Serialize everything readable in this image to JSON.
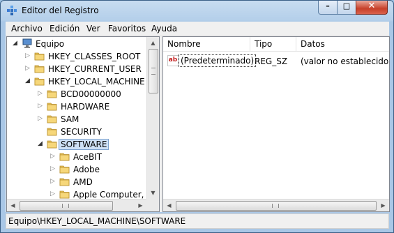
{
  "window": {
    "title": "Editor del Registro"
  },
  "menu": [
    "Archivo",
    "Edición",
    "Ver",
    "Favoritos",
    "Ayuda"
  ],
  "tree": {
    "items": [
      {
        "label": "Equipo",
        "level": 0,
        "arrow": "expanded",
        "icon": "computer-icon",
        "selected": false
      },
      {
        "label": "HKEY_CLASSES_ROOT",
        "level": 1,
        "arrow": "collapsed",
        "icon": "folder-icon",
        "selected": false
      },
      {
        "label": "HKEY_CURRENT_USER",
        "level": 1,
        "arrow": "collapsed",
        "icon": "folder-icon",
        "selected": false
      },
      {
        "label": "HKEY_LOCAL_MACHINE",
        "level": 1,
        "arrow": "expanded",
        "icon": "folder-open-icon",
        "selected": false
      },
      {
        "label": "BCD00000000",
        "level": 2,
        "arrow": "collapsed",
        "icon": "folder-icon",
        "selected": false
      },
      {
        "label": "HARDWARE",
        "level": 2,
        "arrow": "collapsed",
        "icon": "folder-icon",
        "selected": false
      },
      {
        "label": "SAM",
        "level": 2,
        "arrow": "collapsed",
        "icon": "folder-icon",
        "selected": false
      },
      {
        "label": "SECURITY",
        "level": 2,
        "arrow": "none",
        "icon": "folder-icon",
        "selected": false
      },
      {
        "label": "SOFTWARE",
        "level": 2,
        "arrow": "expanded",
        "icon": "folder-open-icon",
        "selected": true
      },
      {
        "label": "AceBIT",
        "level": 3,
        "arrow": "collapsed",
        "icon": "folder-icon",
        "selected": false
      },
      {
        "label": "Adobe",
        "level": 3,
        "arrow": "collapsed",
        "icon": "folder-icon",
        "selected": false
      },
      {
        "label": "AMD",
        "level": 3,
        "arrow": "collapsed",
        "icon": "folder-icon",
        "selected": false
      },
      {
        "label": "Apple Computer, I",
        "level": 3,
        "arrow": "collapsed",
        "icon": "folder-icon",
        "selected": false
      }
    ]
  },
  "list": {
    "columns": [
      "Nombre",
      "Tipo",
      "Datos"
    ],
    "rows": [
      {
        "icon": "string-value-icon",
        "icon_text": "ab",
        "name": "(Predeterminado)",
        "type": "REG_SZ",
        "data": "(valor no establecido)"
      }
    ]
  },
  "status": {
    "path": "Equipo\\HKEY_LOCAL_MACHINE\\SOFTWARE"
  },
  "colors": {
    "selection": "#cfe1f6",
    "folder": "#e8c35a",
    "titlebar": "#b4cfea"
  }
}
